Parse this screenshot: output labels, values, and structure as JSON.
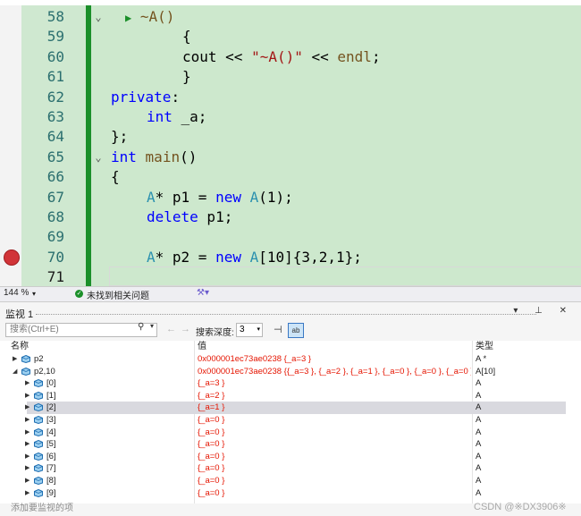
{
  "editor": {
    "lines": [
      {
        "num": "58",
        "fold": "⌄",
        "glyph": "▶",
        "segments": [
          {
            "t": "~A()",
            "c": "fn"
          }
        ]
      },
      {
        "num": "59",
        "segments": [
          {
            "t": "{",
            "c": ""
          }
        ]
      },
      {
        "num": "60",
        "segments": [
          {
            "t": "cout ",
            "c": ""
          },
          {
            "t": "<<",
            "c": ""
          },
          {
            "t": " \"~A()\"",
            "c": "str"
          },
          {
            "t": " << ",
            "c": ""
          },
          {
            "t": "endl",
            "c": "fn"
          },
          {
            "t": ";",
            "c": ""
          }
        ]
      },
      {
        "num": "61",
        "segments": [
          {
            "t": "}",
            "c": ""
          }
        ]
      },
      {
        "num": "62",
        "segments": [
          {
            "t": "private",
            "c": "kw"
          },
          {
            "t": ":",
            "c": ""
          }
        ]
      },
      {
        "num": "63",
        "segments": [
          {
            "t": "int",
            "c": "kw"
          },
          {
            "t": " _a;",
            "c": ""
          }
        ]
      },
      {
        "num": "64",
        "segments": [
          {
            "t": "};",
            "c": ""
          }
        ]
      },
      {
        "num": "65",
        "fold": "⌄",
        "segments": [
          {
            "t": "int",
            "c": "kw"
          },
          {
            "t": " ",
            "c": ""
          },
          {
            "t": "main",
            "c": "fn"
          },
          {
            "t": "()",
            "c": ""
          }
        ]
      },
      {
        "num": "66",
        "segments": [
          {
            "t": "{",
            "c": ""
          }
        ]
      },
      {
        "num": "67",
        "segments": [
          {
            "t": "A",
            "c": "ty"
          },
          {
            "t": "* p1 = ",
            "c": ""
          },
          {
            "t": "new",
            "c": "kw"
          },
          {
            "t": " ",
            "c": ""
          },
          {
            "t": "A",
            "c": "ty"
          },
          {
            "t": "(1);",
            "c": ""
          }
        ]
      },
      {
        "num": "68",
        "segments": [
          {
            "t": "delete",
            "c": "kw"
          },
          {
            "t": " p1;",
            "c": ""
          }
        ]
      },
      {
        "num": "69",
        "segments": []
      },
      {
        "num": "70",
        "breakpoint": true,
        "segments": [
          {
            "t": "A",
            "c": "ty"
          },
          {
            "t": "* p2 = ",
            "c": ""
          },
          {
            "t": "new",
            "c": "kw"
          },
          {
            "t": " ",
            "c": ""
          },
          {
            "t": "A",
            "c": "ty"
          },
          {
            "t": "[10]{3,2,1};",
            "c": ""
          }
        ]
      },
      {
        "num": "71",
        "current": true,
        "segments": []
      }
    ],
    "indents": [
      1,
      2,
      2,
      2,
      0,
      1,
      0,
      0,
      0,
      1,
      1,
      1,
      1,
      1
    ]
  },
  "status": {
    "zoom": "144 %",
    "zoom_arrow": "▾",
    "issues": "未找到相关问题",
    "ok_glyph": "✓",
    "brush_glyph": "⚒▾"
  },
  "watch": {
    "title": "监视 1",
    "window_buttons": "▾ ⊥ ✕",
    "search_placeholder": "搜索(Ctrl+E)",
    "search_icon": "⚲",
    "search_drop": "▾",
    "back_glyph": "←",
    "fwd_glyph": "→",
    "depth_label": "搜索深度:",
    "depth_value": "3",
    "depth_arrow": "▾",
    "pin_glyph": "⊣",
    "hex_glyph": "ab",
    "headers": {
      "name": "名称",
      "value": "值",
      "type": "类型"
    },
    "rows": [
      {
        "indent": 0,
        "twisty": "▶",
        "name": "p2",
        "value": "0x000001ec73ae0238 {_a=3 }",
        "type": "A *"
      },
      {
        "indent": 0,
        "twisty": "◢",
        "name": "p2,10",
        "value": "0x000001ec73ae0238 {{_a=3 }, {_a=2 }, {_a=1 }, {_a=0 }, {_a=0 }, {_a=0 }, {_a...",
        "type": "A[10]"
      },
      {
        "indent": 1,
        "twisty": "▶",
        "name": "[0]",
        "value": "{_a=3 }",
        "type": "A"
      },
      {
        "indent": 1,
        "twisty": "▶",
        "name": "[1]",
        "value": "{_a=2 }",
        "type": "A"
      },
      {
        "indent": 1,
        "twisty": "▶",
        "name": "[2]",
        "value": "{_a=1 }",
        "type": "A",
        "selected": true
      },
      {
        "indent": 1,
        "twisty": "▶",
        "name": "[3]",
        "value": "{_a=0 }",
        "type": "A"
      },
      {
        "indent": 1,
        "twisty": "▶",
        "name": "[4]",
        "value": "{_a=0 }",
        "type": "A"
      },
      {
        "indent": 1,
        "twisty": "▶",
        "name": "[5]",
        "value": "{_a=0 }",
        "type": "A"
      },
      {
        "indent": 1,
        "twisty": "▶",
        "name": "[6]",
        "value": "{_a=0 }",
        "type": "A"
      },
      {
        "indent": 1,
        "twisty": "▶",
        "name": "[7]",
        "value": "{_a=0 }",
        "type": "A"
      },
      {
        "indent": 1,
        "twisty": "▶",
        "name": "[8]",
        "value": "{_a=0 }",
        "type": "A"
      },
      {
        "indent": 1,
        "twisty": "▶",
        "name": "[9]",
        "value": "{_a=0 }",
        "type": "A"
      }
    ],
    "add_watch": "添加要监视的项"
  },
  "watermark": "CSDN @※DX3906※",
  "colors": {
    "value_red": "#e51400",
    "change_bar": "#1b8f2a",
    "breakpoint": "#d13438",
    "code_bg": "#cde8cd"
  }
}
